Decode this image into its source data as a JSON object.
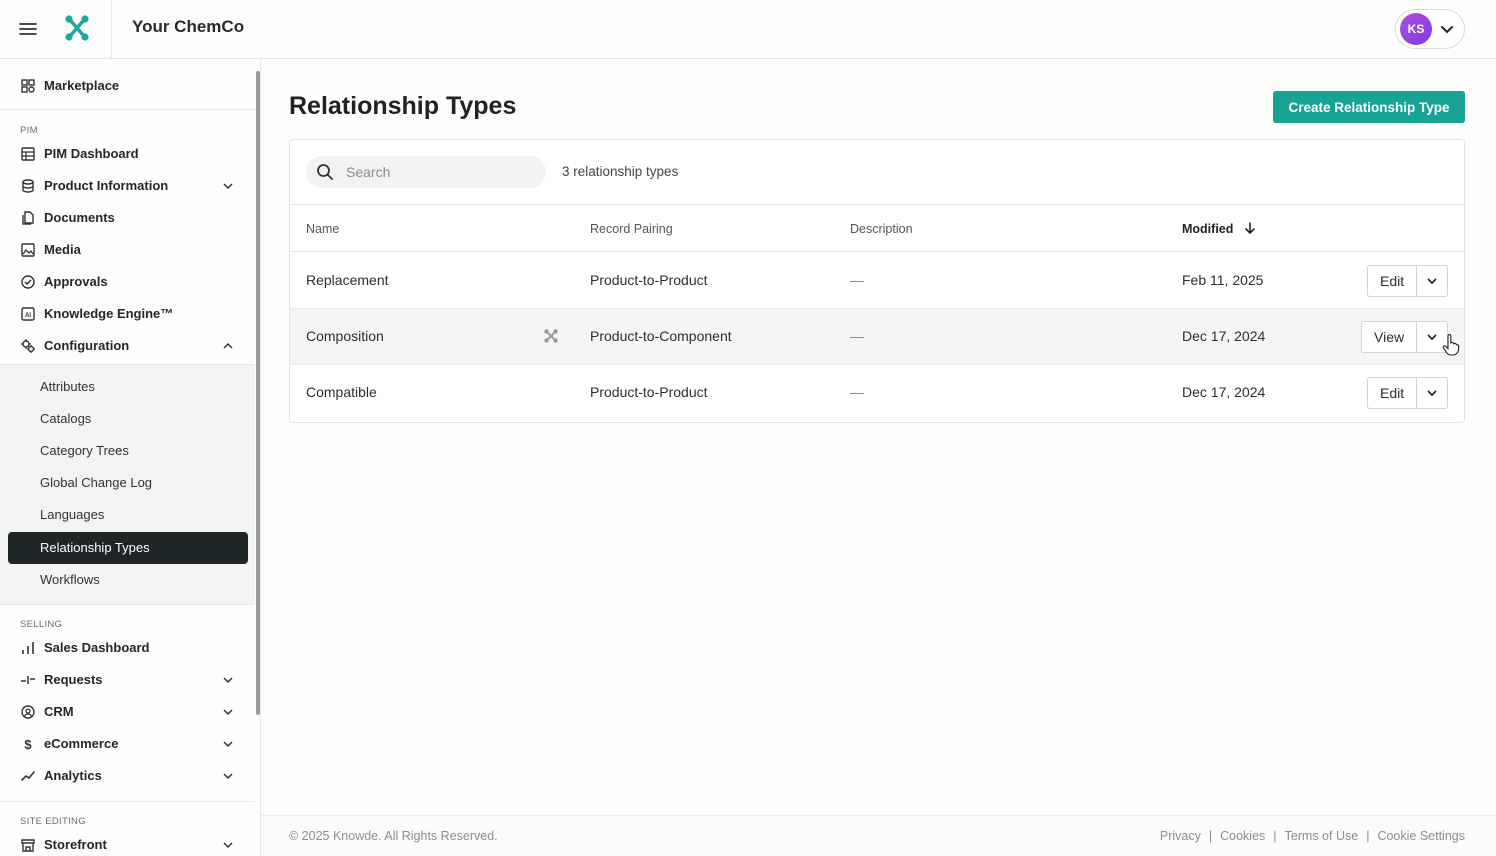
{
  "header": {
    "company": "Your ChemCo",
    "user_initials": "KS"
  },
  "sidebar": {
    "marketplace": "Marketplace",
    "sections": {
      "pim": "PIM",
      "selling": "SELLING",
      "site_editing": "SITE EDITING"
    },
    "pim_items": [
      {
        "label": "PIM Dashboard",
        "icon": "dashboard-icon"
      },
      {
        "label": "Product Information",
        "icon": "database-icon"
      },
      {
        "label": "Documents",
        "icon": "documents-icon"
      },
      {
        "label": "Media",
        "icon": "media-icon"
      },
      {
        "label": "Approvals",
        "icon": "approvals-icon"
      },
      {
        "label": "Knowledge Engine™",
        "icon": "ai-icon"
      },
      {
        "label": "Configuration",
        "icon": "configuration-icon"
      }
    ],
    "config_items": [
      "Attributes",
      "Catalogs",
      "Category Trees",
      "Global Change Log",
      "Languages",
      "Relationship Types",
      "Workflows"
    ],
    "active_config_item": "Relationship Types",
    "selling_items": [
      {
        "label": "Sales Dashboard",
        "icon": "bar-chart-icon"
      },
      {
        "label": "Requests",
        "icon": "requests-icon"
      },
      {
        "label": "CRM",
        "icon": "crm-icon"
      },
      {
        "label": "eCommerce",
        "icon": "dollar-icon"
      },
      {
        "label": "Analytics",
        "icon": "analytics-icon"
      }
    ],
    "site_items": [
      {
        "label": "Storefront",
        "icon": "storefront-icon"
      }
    ]
  },
  "main": {
    "title": "Relationship Types",
    "create_button": "Create Relationship Type",
    "search_placeholder": "Search",
    "count_text": "3 relationship types",
    "columns": {
      "name": "Name",
      "pairing": "Record Pairing",
      "description": "Description",
      "modified": "Modified"
    },
    "rows": [
      {
        "name": "Replacement",
        "pairing": "Product-to-Product",
        "description": "—",
        "modified": "Feb 11, 2025",
        "action": "Edit"
      },
      {
        "name": "Composition",
        "pairing": "Product-to-Component",
        "description": "—",
        "modified": "Dec 17, 2024",
        "action": "View"
      },
      {
        "name": "Compatible",
        "pairing": "Product-to-Product",
        "description": "—",
        "modified": "Dec 17, 2024",
        "action": "Edit"
      }
    ]
  },
  "footer": {
    "copyright": "© 2025 Knowde. All Rights Reserved.",
    "links": [
      "Privacy",
      "Cookies",
      "Terms of Use",
      "Cookie Settings"
    ],
    "separator": "|"
  },
  "colors": {
    "accent": "#16a394",
    "active_nav": "#1f2628"
  }
}
